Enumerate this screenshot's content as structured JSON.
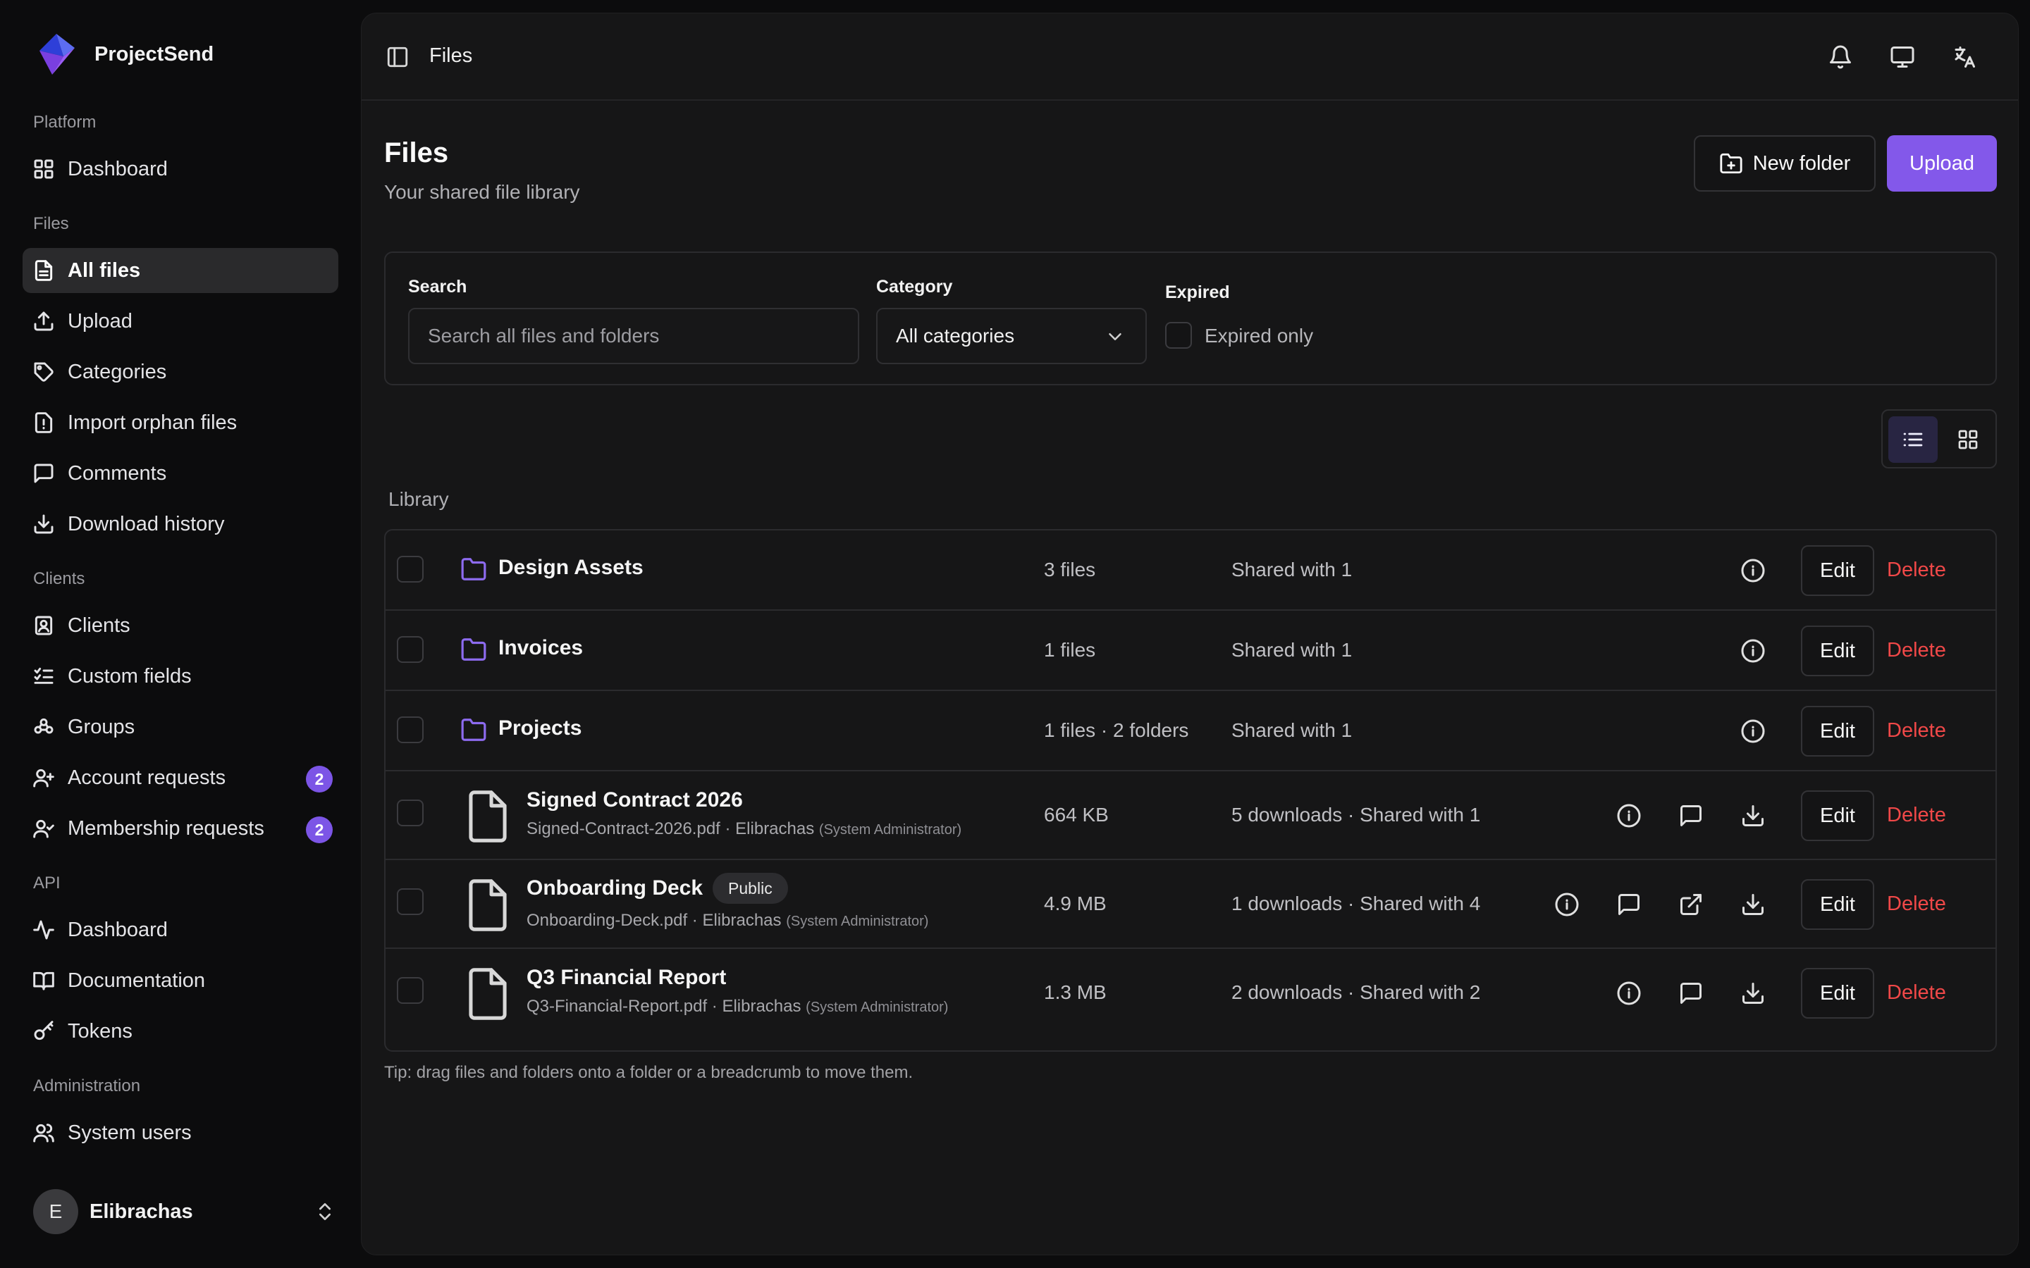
{
  "brand": {
    "name": "ProjectSend"
  },
  "sidebar": {
    "sections": {
      "platform": "Platform",
      "files": "Files",
      "clients": "Clients",
      "api": "API",
      "administration": "Administration"
    },
    "items": {
      "dashboard": "Dashboard",
      "all_files": "All files",
      "upload": "Upload",
      "categories": "Categories",
      "import_orphan": "Import orphan files",
      "comments": "Comments",
      "download_history": "Download history",
      "clients": "Clients",
      "custom_fields": "Custom fields",
      "groups": "Groups",
      "account_requests": "Account requests",
      "account_requests_count": "2",
      "membership_requests": "Membership requests",
      "membership_requests_count": "2",
      "api_dashboard": "Dashboard",
      "documentation": "Documentation",
      "tokens": "Tokens",
      "system_users": "System users"
    },
    "user": {
      "initial": "E",
      "name": "Elibrachas"
    }
  },
  "topbar": {
    "breadcrumb": "Files"
  },
  "header": {
    "title": "Files",
    "subtitle": "Your shared file library",
    "new_folder": "New folder",
    "upload": "Upload"
  },
  "filters": {
    "search_label": "Search",
    "search_placeholder": "Search all files and folders",
    "category_label": "Category",
    "category_value": "All categories",
    "expired_label": "Expired",
    "expired_only": "Expired only"
  },
  "library": {
    "label": "Library",
    "edit": "Edit",
    "delete": "Delete",
    "folders": [
      {
        "name": "Design Assets",
        "count": "3 files",
        "shared": "Shared with 1"
      },
      {
        "name": "Invoices",
        "count": "1 files",
        "shared": "Shared with 1"
      },
      {
        "name": "Projects",
        "count": "1 files · 2 folders",
        "shared": "Shared with 1"
      }
    ],
    "files": [
      {
        "title": "Signed Contract 2026",
        "filename": "Signed-Contract-2026.pdf · Elibrachas",
        "role": "(System Administrator)",
        "size": "664 KB",
        "stats": "5 downloads · Shared with 1"
      },
      {
        "title": "Onboarding Deck",
        "badge": "Public",
        "filename": "Onboarding-Deck.pdf · Elibrachas",
        "role": "(System Administrator)",
        "size": "4.9 MB",
        "stats": "1 downloads · Shared with 4"
      },
      {
        "title": "Q3 Financial Report",
        "filename": "Q3-Financial-Report.pdf · Elibrachas",
        "role": "(System Administrator)",
        "size": "1.3 MB",
        "stats": "2 downloads · Shared with 2"
      }
    ]
  },
  "tip": "Tip: drag files and folders onto a folder or a breadcrumb to move them.",
  "colors": {
    "accent": "#8358ea",
    "danger": "#f04848",
    "folder": "#8d6bf0"
  }
}
